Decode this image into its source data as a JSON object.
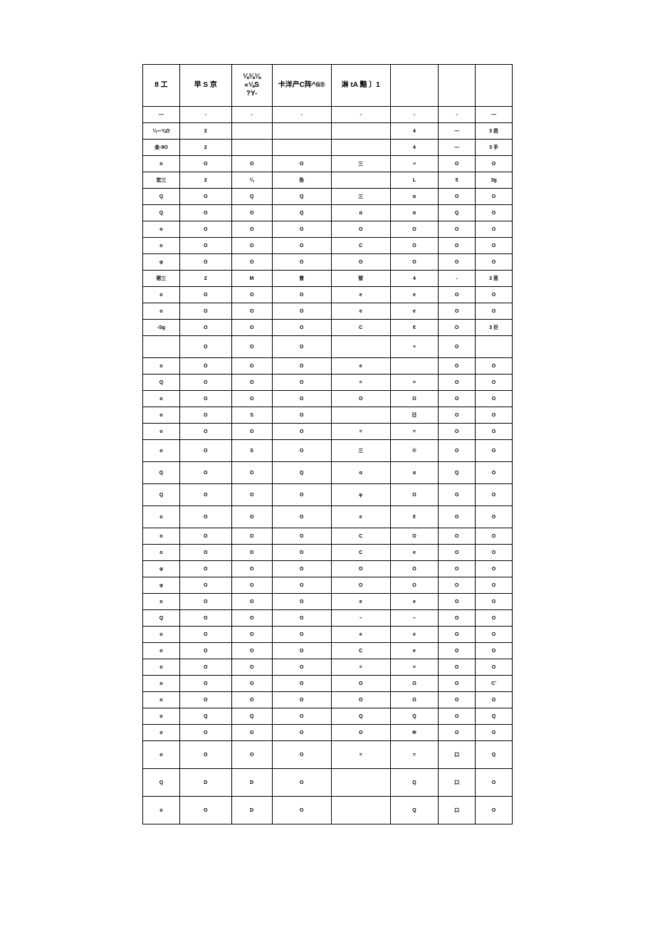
{
  "headers": [
    "8 工",
    "早 S 京",
    "⅛⅛⅛\n«⅛S\n?Y-",
    "卡洋产C阵^Ii®",
    "淋 tA 黯 〕1",
    "",
    "",
    ""
  ],
  "rows": [
    {
      "cls": "",
      "c": [
        "—",
        "-",
        "-",
        "-",
        "-",
        "-",
        "-",
        "—"
      ]
    },
    {
      "cls": "",
      "c": [
        "¼—⅜O",
        "2",
        "",
        "",
        "",
        "4",
        "—",
        "3 邑"
      ]
    },
    {
      "cls": "",
      "c": [
        "金-9O",
        "2",
        "",
        "",
        "",
        "4",
        "—",
        "3 手"
      ]
    },
    {
      "cls": "",
      "c": [
        "o",
        "O",
        "O",
        "O",
        "三",
        "≡",
        "O",
        "O"
      ]
    },
    {
      "cls": "",
      "c": [
        "宏三",
        "2",
        "¼",
        "告",
        "",
        "L",
        "5",
        "3g"
      ]
    },
    {
      "cls": "",
      "c": [
        "Q",
        "O",
        "Q",
        "Q",
        "三",
        "α",
        "O",
        "O"
      ]
    },
    {
      "cls": "",
      "c": [
        "Q",
        "O",
        "O",
        "Q",
        "α",
        "α",
        "Q",
        "O"
      ]
    },
    {
      "cls": "",
      "c": [
        "o",
        "O",
        "O",
        "O",
        "O",
        "O",
        "O",
        "O"
      ]
    },
    {
      "cls": "",
      "c": [
        "o",
        "O",
        "O",
        "O",
        "C",
        "O",
        "O",
        "O"
      ]
    },
    {
      "cls": "",
      "c": [
        "φ",
        "O",
        "O",
        "O",
        "O",
        "O",
        "O",
        "O"
      ]
    },
    {
      "cls": "",
      "c": [
        "密三",
        "2",
        "M",
        "曾",
        "管",
        "4",
        "-",
        "3 莒"
      ]
    },
    {
      "cls": "",
      "c": [
        "o",
        "O",
        "O",
        "O",
        "e",
        "e",
        "O",
        "O"
      ]
    },
    {
      "cls": "",
      "c": [
        "o",
        "O",
        "O",
        "O",
        "e",
        "e",
        "O",
        "O"
      ]
    },
    {
      "cls": "",
      "c": [
        "-Sg",
        "O",
        "O",
        "O",
        "C",
        "€",
        "O",
        "3 巨"
      ]
    },
    {
      "cls": "tall",
      "c": [
        "",
        "O",
        "O",
        "O",
        "",
        "≡",
        "O",
        ""
      ]
    },
    {
      "cls": "",
      "c": [
        "o",
        "O",
        "O",
        "O",
        "e",
        "",
        "O",
        "O"
      ]
    },
    {
      "cls": "",
      "c": [
        "Q",
        "O",
        "O",
        "O",
        "=",
        "=",
        "O",
        "O"
      ]
    },
    {
      "cls": "",
      "c": [
        "o",
        "O",
        "O",
        "O",
        "O",
        "O",
        "O",
        "O"
      ]
    },
    {
      "cls": "",
      "c": [
        "o",
        "O",
        "S",
        "O",
        "",
        "日",
        "O",
        "O"
      ]
    },
    {
      "cls": "",
      "c": [
        "o",
        "O",
        "O",
        "O",
        "=",
        "=",
        "O",
        "O"
      ]
    },
    {
      "cls": "tall",
      "c": [
        "o",
        "O",
        "S",
        "O",
        "三",
        "®",
        "O",
        "O"
      ]
    },
    {
      "cls": "tall",
      "c": [
        "Q",
        "O",
        "O",
        "Q",
        "α",
        "α",
        "Q",
        "O"
      ]
    },
    {
      "cls": "tall",
      "c": [
        "Q",
        "O",
        "O",
        "O",
        "φ",
        "O",
        "O",
        "O"
      ]
    },
    {
      "cls": "tall",
      "c": [
        "o",
        "O",
        "O",
        "O",
        "e",
        "€",
        "O",
        "O"
      ]
    },
    {
      "cls": "",
      "c": [
        "o",
        "O",
        "O",
        "O",
        "C",
        "O",
        "O",
        "O"
      ]
    },
    {
      "cls": "",
      "c": [
        "o",
        "O",
        "O",
        "O",
        "C",
        "e",
        "O",
        "O"
      ]
    },
    {
      "cls": "",
      "c": [
        "φ",
        "O",
        "O",
        "O",
        "O",
        "O",
        "O",
        "O"
      ]
    },
    {
      "cls": "",
      "c": [
        "φ",
        "O",
        "O",
        "O",
        "O",
        "O",
        "O",
        "O"
      ]
    },
    {
      "cls": "",
      "c": [
        "o",
        "O",
        "O",
        "O",
        "e",
        "e",
        "O",
        "O"
      ]
    },
    {
      "cls": "",
      "c": [
        "Q",
        "O",
        "O",
        "O",
        "–",
        "–",
        "O",
        "O"
      ]
    },
    {
      "cls": "",
      "c": [
        "o",
        "O",
        "O",
        "O",
        "e",
        "e",
        "O",
        "O"
      ]
    },
    {
      "cls": "",
      "c": [
        "o",
        "O",
        "O",
        "O",
        "C",
        "e",
        "O",
        "O"
      ]
    },
    {
      "cls": "",
      "c": [
        "o",
        "O",
        "O",
        "O",
        "=",
        "=",
        "O",
        "O"
      ]
    },
    {
      "cls": "",
      "c": [
        "o",
        "O",
        "O",
        "O",
        "O",
        "O",
        "O",
        "Cʹ"
      ]
    },
    {
      "cls": "",
      "c": [
        "o",
        "O",
        "O",
        "O",
        "O",
        "O",
        "O",
        "O"
      ]
    },
    {
      "cls": "",
      "c": [
        "o",
        "Q",
        "Q",
        "O",
        "Q",
        "Q",
        "O",
        "Q"
      ]
    },
    {
      "cls": "",
      "c": [
        "o",
        "O",
        "O",
        "O",
        "O",
        "Φ",
        "O",
        "O"
      ]
    },
    {
      "cls": "taller",
      "c": [
        "o",
        "O",
        "O",
        "O",
        "=",
        "=",
        "口",
        "Q"
      ]
    },
    {
      "cls": "taller",
      "c": [
        "Q",
        "D",
        "D",
        "O",
        "",
        "Q",
        "口",
        "O"
      ]
    },
    {
      "cls": "taller",
      "c": [
        "o",
        "O",
        "D",
        "O",
        "",
        "Q",
        "口",
        "O"
      ]
    }
  ]
}
